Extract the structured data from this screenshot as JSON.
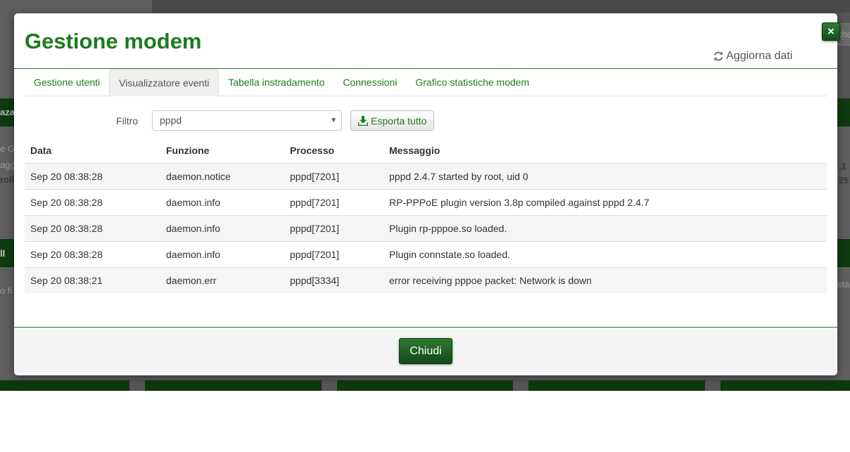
{
  "background": {
    "fragments": [
      "che",
      "aza",
      "e G",
      "agg",
      "roll",
      ".1",
      "25",
      "ll",
      "o fi",
      "sta"
    ]
  },
  "modal": {
    "title": "Gestione modem",
    "refresh_label": "Aggiorna dati",
    "close_symbol": "×",
    "tabs": [
      {
        "label": "Gestione utenti",
        "active": false
      },
      {
        "label": "Visualizzatore eventi",
        "active": true
      },
      {
        "label": "Tabella instradamento",
        "active": false
      },
      {
        "label": "Connessioni",
        "active": false
      },
      {
        "label": "Grafico statistiche modem",
        "active": false
      }
    ],
    "filter": {
      "label": "Filtro",
      "selected": "pppd"
    },
    "export_label": "Esporta tutto",
    "table": {
      "columns": [
        "Data",
        "Funzione",
        "Processo",
        "Messaggio"
      ],
      "rows": [
        [
          "Sep 20 08:38:28",
          "daemon.notice",
          "pppd[7201]",
          "pppd 2.4.7 started by root, uid 0"
        ],
        [
          "Sep 20 08:38:28",
          "daemon.info",
          "pppd[7201]",
          "RP-PPPoE plugin version 3.8p compiled against pppd 2.4.7"
        ],
        [
          "Sep 20 08:38:28",
          "daemon.info",
          "pppd[7201]",
          "Plugin rp-pppoe.so loaded."
        ],
        [
          "Sep 20 08:38:28",
          "daemon.info",
          "pppd[7201]",
          "Plugin connstate.so loaded."
        ],
        [
          "Sep 20 08:38:21",
          "daemon.err",
          "pppd[3334]",
          "error receiving pppoe packet: Network is down"
        ]
      ]
    },
    "footer_button": "Chiudi"
  },
  "colors": {
    "accent": "#1e7b1e",
    "button_dark": "#124d15"
  },
  "icons": {
    "refresh": "refresh-icon",
    "download": "download-icon",
    "close": "close-icon",
    "caret": "caret-down-icon"
  }
}
